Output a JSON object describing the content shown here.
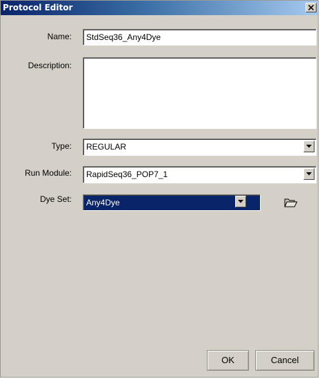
{
  "window": {
    "title": "Protocol Editor",
    "close_glyph": "close-icon"
  },
  "form": {
    "name": {
      "label": "Name:",
      "value": "StdSeq36_Any4Dye"
    },
    "description": {
      "label": "Description:",
      "value": ""
    },
    "type": {
      "label": "Type:",
      "value": "REGULAR"
    },
    "run_module": {
      "label": "Run Module:",
      "value": "RapidSeq36_POP7_1"
    },
    "dye_set": {
      "label": "Dye Set:",
      "value": "Any4Dye"
    }
  },
  "buttons": {
    "ok": "OK",
    "cancel": "Cancel"
  },
  "icons": {
    "close": "close-icon",
    "dropdown": "chevron-down-icon",
    "browse": "folder-open-icon"
  },
  "colors": {
    "title_bar_start": "#0a246a",
    "title_bar_end": "#a6caf0",
    "dialog_background": "#d4d0c8",
    "selection": "#0a246a"
  }
}
